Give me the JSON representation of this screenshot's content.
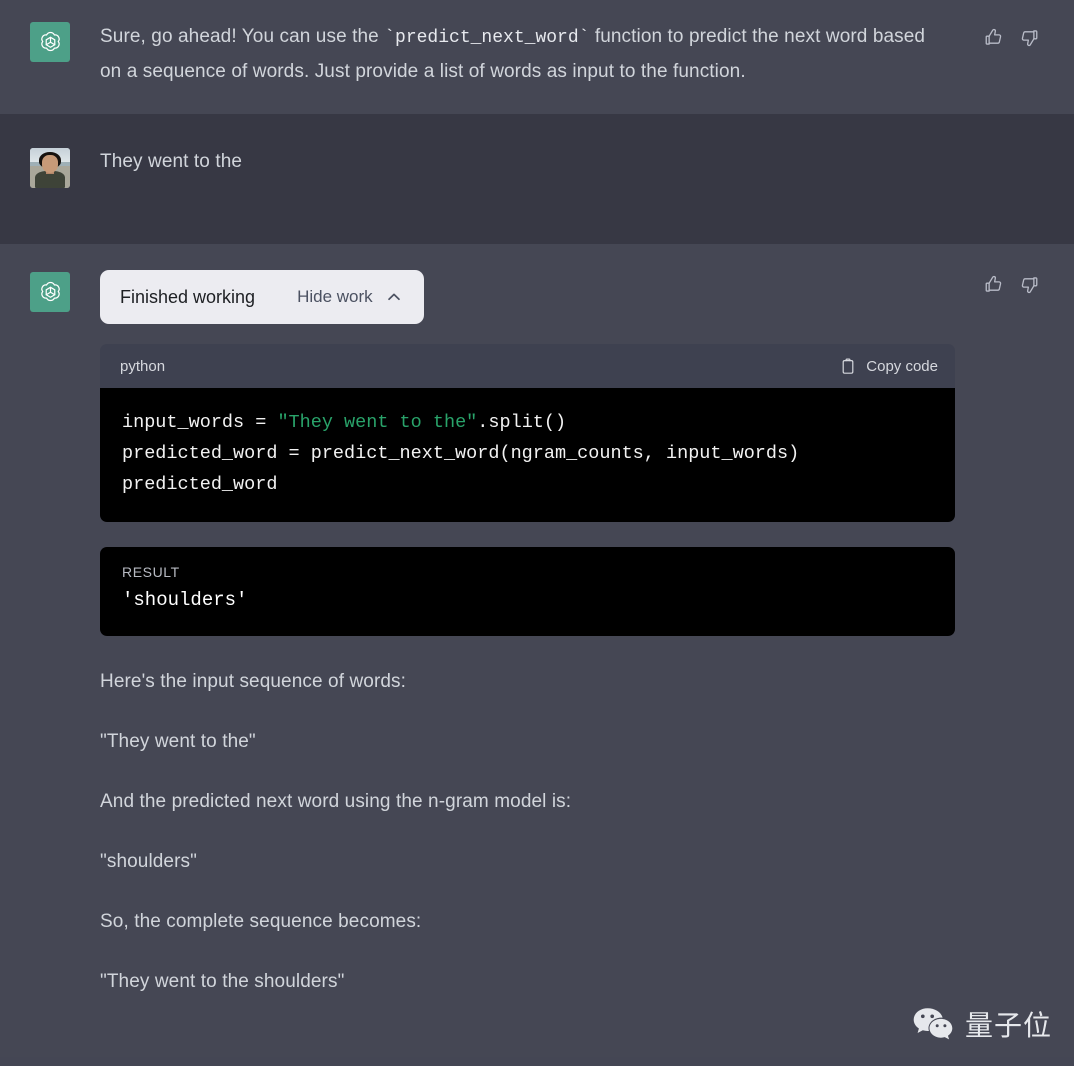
{
  "messages": [
    {
      "role": "assistant",
      "avatar_icon": "openai-logo-icon",
      "text_part1": "Sure, go ahead! You can use the ",
      "inline_code": "`predict_next_word`",
      "text_part2": " function to predict the next word based on a sequence of words. Just provide a list of words as input to the function."
    },
    {
      "role": "user",
      "avatar_icon": "user-photo-avatar",
      "text": "They went to the"
    }
  ],
  "tool_block": {
    "pill_title": "Finished working",
    "pill_toggle_label": "Hide work",
    "pill_toggle_icon": "chevron-up-icon",
    "code": {
      "language": "python",
      "copy_label": "Copy code",
      "copy_icon": "clipboard-icon",
      "line1_pre": "input_words = ",
      "line1_string": "\"They went to the\"",
      "line1_post": ".split()",
      "line2": "predicted_word = predict_next_word(ngram_counts, input_words)",
      "line3": "predicted_word"
    },
    "result": {
      "label": "RESULT",
      "value": "'shoulders'"
    }
  },
  "answer_paragraphs": [
    "Here's the input sequence of words:",
    "\"They went to the\"",
    "And the predicted next word using the n-gram model is:",
    "\"shoulders\"",
    "So, the complete sequence becomes:",
    "\"They went to the shoulders\""
  ],
  "feedback": {
    "thumbs_up_icon": "thumbs-up-icon",
    "thumbs_down_icon": "thumbs-down-icon"
  },
  "watermark": {
    "icon": "wechat-icon",
    "text": "量子位"
  },
  "colors": {
    "assistant_row_bg": "#454754",
    "user_row_bg": "#373844",
    "accent_green": "#4da088",
    "code_bg": "#000000",
    "code_header_bg": "#3e4150",
    "code_string_green": "#29a36a",
    "pill_bg": "#ececf1",
    "text_primary": "#d1d5db"
  }
}
